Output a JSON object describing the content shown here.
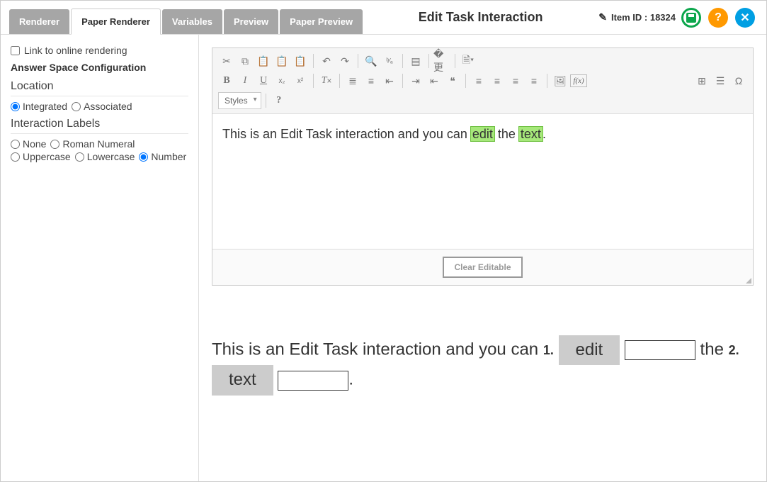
{
  "header": {
    "title": "Edit Task Interaction",
    "item_id_label": "Item ID : 18324",
    "tabs": [
      {
        "label": "Renderer",
        "active": false
      },
      {
        "label": "Paper Renderer",
        "active": true
      },
      {
        "label": "Variables",
        "active": false
      },
      {
        "label": "Preview",
        "active": false
      },
      {
        "label": "Paper Preview",
        "active": false
      }
    ]
  },
  "sidebar": {
    "link_online_label": "Link to online rendering",
    "config_heading": "Answer Space Configuration",
    "location": {
      "label": "Location",
      "options": [
        {
          "label": "Integrated",
          "checked": true
        },
        {
          "label": "Associated",
          "checked": false
        }
      ]
    },
    "interaction_labels": {
      "label": "Interaction Labels",
      "options": [
        {
          "label": "None",
          "checked": false
        },
        {
          "label": "Roman Numeral",
          "checked": false
        },
        {
          "label": "Uppercase",
          "checked": false
        },
        {
          "label": "Lowercase",
          "checked": false
        },
        {
          "label": "Number",
          "checked": true
        }
      ]
    }
  },
  "editor": {
    "styles_label": "Styles",
    "clear_label": "Clear Editable",
    "content": {
      "pre": "This is an Edit Task interaction and you can ",
      "hl1": "edit",
      "mid": " the ",
      "hl2": "text",
      "post": "."
    }
  },
  "paper_preview": {
    "pre": "This is an Edit Task interaction and you can ",
    "n1": "1.",
    "ans1": "edit",
    "mid": " the ",
    "n2": "2.",
    "ans2": "text",
    "post": "."
  }
}
